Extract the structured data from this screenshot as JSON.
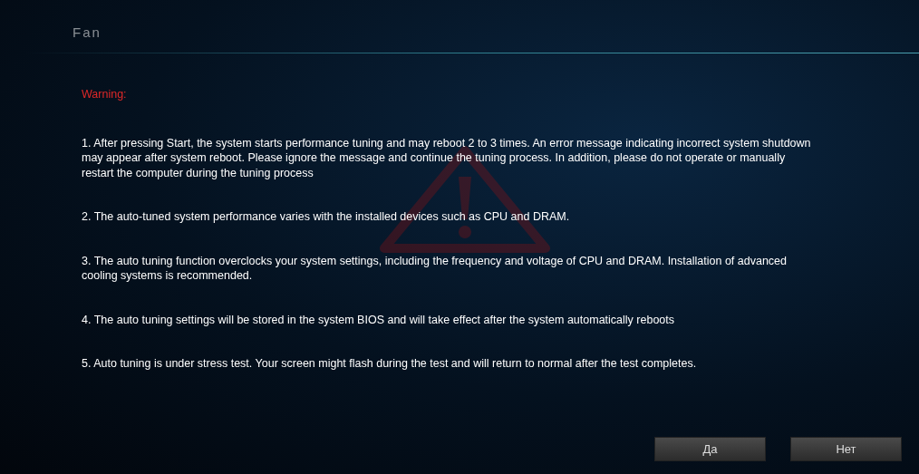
{
  "title": "Fan",
  "warning": {
    "heading": "Warning:",
    "items": [
      "1. After pressing Start, the system starts performance tuning and may reboot 2 to 3 times. An error message indicating incorrect system shutdown may appear after system reboot. Please ignore the message and continue the tuning process. In addition, please do not operate or manually restart the computer during the tuning process",
      "2. The auto-tuned system performance varies with the installed devices such as CPU and DRAM.",
      "3. The auto tuning function overclocks your system settings, including the frequency and voltage of CPU and DRAM. Installation of advanced cooling systems is recommended.",
      "4. The auto tuning settings will be stored in the system BIOS and will take effect after the system automatically reboots",
      "5. Auto tuning is under stress test. Your screen might flash during the test and will return to normal after the test completes."
    ]
  },
  "buttons": [
    "Да",
    "Нет"
  ]
}
